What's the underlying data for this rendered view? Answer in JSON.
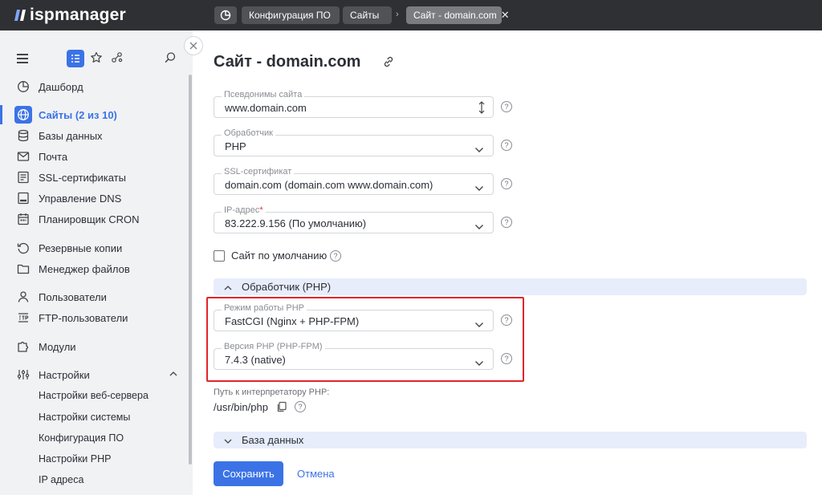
{
  "app": {
    "logo_text": "ispmanager"
  },
  "breadcrumbs": [
    {
      "label": "Конфигурация ПО"
    },
    {
      "label": "Сайты"
    },
    {
      "label": "Сайт - domain.com",
      "close": "✕"
    }
  ],
  "sidebar": {
    "items": [
      {
        "label": "Дашборд",
        "icon": "dashboard-icon"
      },
      {
        "label": "Сайты (2 из 10)",
        "icon": "globe-icon",
        "active": true
      },
      {
        "label": "Базы данных",
        "icon": "database-icon"
      },
      {
        "label": "Почта",
        "icon": "mail-icon"
      },
      {
        "label": "SSL-сертификаты",
        "icon": "certificate-icon"
      },
      {
        "label": "Управление DNS",
        "icon": "dns-icon"
      },
      {
        "label": "Планировщик CRON",
        "icon": "calendar-icon"
      },
      {
        "label": "Резервные копии",
        "icon": "backup-icon"
      },
      {
        "label": "Менеджер файлов",
        "icon": "folder-icon"
      },
      {
        "label": "Пользователи",
        "icon": "user-icon"
      },
      {
        "label": "FTP-пользователи",
        "icon": "ftp-icon"
      },
      {
        "label": "Модули",
        "icon": "puzzle-icon"
      },
      {
        "label": "Настройки",
        "icon": "settings-icon"
      }
    ],
    "sub_items": [
      {
        "label": "Настройки веб-сервера"
      },
      {
        "label": "Настройки системы"
      },
      {
        "label": "Конфигурация ПО"
      },
      {
        "label": "Настройки PHP"
      },
      {
        "label": "IP адреса"
      }
    ]
  },
  "main": {
    "title": "Сайт - domain.com",
    "fields": {
      "aliases": {
        "label": "Псевдонимы сайта",
        "value": "www.domain.com"
      },
      "handler": {
        "label": "Обработчик",
        "value": "PHP"
      },
      "ssl": {
        "label": "SSL-сертификат",
        "value": "domain.com (domain.com www.domain.com)"
      },
      "ip": {
        "label": "IP-адрес",
        "required_mark": "*",
        "value": "83.222.9.156 (По умолчанию)"
      },
      "php_mode": {
        "label": "Режим работы PHP",
        "value": "FastCGI (Nginx + PHP-FPM)"
      },
      "php_version": {
        "label": "Версия PHP (PHP-FPM)",
        "value": "7.4.3 (native)"
      }
    },
    "default_site": {
      "label": "Сайт по умолчанию",
      "checked": false
    },
    "section_php": {
      "title": "Обработчик (PHP)",
      "expanded": true
    },
    "php_path": {
      "label": "Путь к интерпретатору PHP:",
      "value": "/usr/bin/php"
    },
    "section_db": {
      "title": "База данных",
      "expanded": false
    },
    "help_glyph": "?",
    "buttons": {
      "save": "Сохранить",
      "cancel": "Отмена"
    }
  },
  "colors": {
    "accent": "#3b73e6",
    "topbar": "#2f3033",
    "highlight": "#e1252d",
    "section_bg": "#e8edfb"
  }
}
